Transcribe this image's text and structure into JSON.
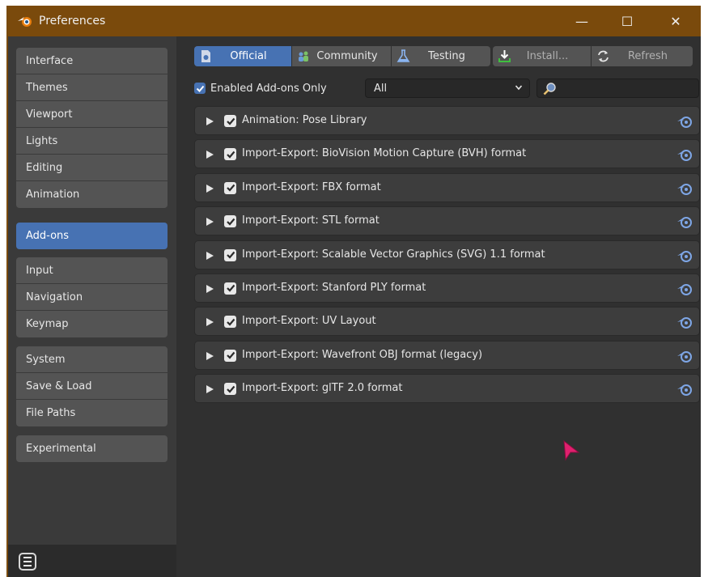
{
  "window": {
    "title": "Preferences",
    "minimize": "—",
    "maximize": "☐",
    "close": "✕"
  },
  "sidebar": {
    "groups": [
      [
        "Interface",
        "Themes",
        "Viewport",
        "Lights",
        "Editing",
        "Animation"
      ],
      [
        "Add-ons"
      ],
      [
        "Input",
        "Navigation",
        "Keymap"
      ],
      [
        "System",
        "Save & Load",
        "File Paths"
      ],
      [
        "Experimental"
      ]
    ],
    "active": "Add-ons"
  },
  "toolbar": {
    "support_tabs": [
      {
        "label": "Official",
        "icon": "blend-file-icon",
        "active": true
      },
      {
        "label": "Community",
        "icon": "community-icon",
        "active": false
      },
      {
        "label": "Testing",
        "icon": "flask-icon",
        "active": false
      }
    ],
    "install_label": "Install...",
    "refresh_label": "Refresh"
  },
  "filter": {
    "enabled_only_label": "Enabled Add-ons Only",
    "enabled_only_checked": true,
    "category_value": "All",
    "search_placeholder": ""
  },
  "addons": [
    {
      "name": "Animation: Pose Library",
      "enabled": true
    },
    {
      "name": "Import-Export: BioVision Motion Capture (BVH) format",
      "enabled": true
    },
    {
      "name": "Import-Export: FBX format",
      "enabled": true
    },
    {
      "name": "Import-Export: STL format",
      "enabled": true
    },
    {
      "name": "Import-Export: Scalable Vector Graphics (SVG) 1.1 format",
      "enabled": true
    },
    {
      "name": "Import-Export: Stanford PLY format",
      "enabled": true
    },
    {
      "name": "Import-Export: UV Layout",
      "enabled": true
    },
    {
      "name": "Import-Export: Wavefront OBJ format (legacy)",
      "enabled": true
    },
    {
      "name": "Import-Export: glTF 2.0 format",
      "enabled": true
    }
  ],
  "colors": {
    "titlebar": "#7a4a0c",
    "accent": "#4772b3",
    "panel": "#303030",
    "cursor": "#e0206e"
  }
}
